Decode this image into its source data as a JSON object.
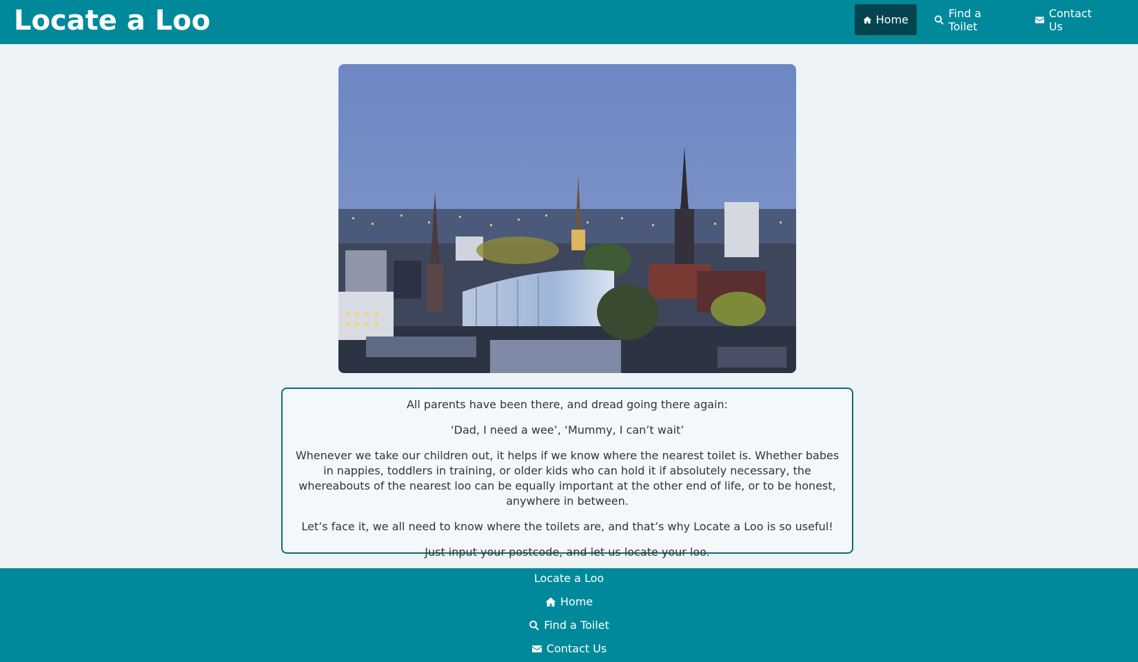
{
  "brand": "Locate a Loo",
  "nav": {
    "home": {
      "label": "Home",
      "icon": "home-icon"
    },
    "find": {
      "label": "Find a Toilet",
      "icon": "search-icon"
    },
    "contact": {
      "label": "Contact Us",
      "icon": "envelope-icon"
    }
  },
  "intro": {
    "p1": "All parents have been there, and dread going there again:",
    "p2": "‘Dad, I need a wee’, ‘Mummy, I can’t wait’",
    "p3": "Whenever we take our children out, it helps if we know where the nearest toilet is. Whether babes in nappies, toddlers in training, or older kids who can hold it if absolutely necessary, the whereabouts of the nearest loo can be equally important at the other end of life, or to be honest, anywhere in between.",
    "p4": "Let’s face it, we all need to know where the toilets are, and that’s why Locate a Loo is so useful!",
    "p5": "Just input your postcode, and let us locate your loo."
  },
  "footer": {
    "title": "Locate a Loo",
    "home": "Home",
    "find": "Find a Toilet",
    "contact": "Contact Us"
  },
  "colors": {
    "primary": "#00899b",
    "active_nav": "#03454f",
    "border": "#0c6a78",
    "background": "#edf3f6"
  }
}
